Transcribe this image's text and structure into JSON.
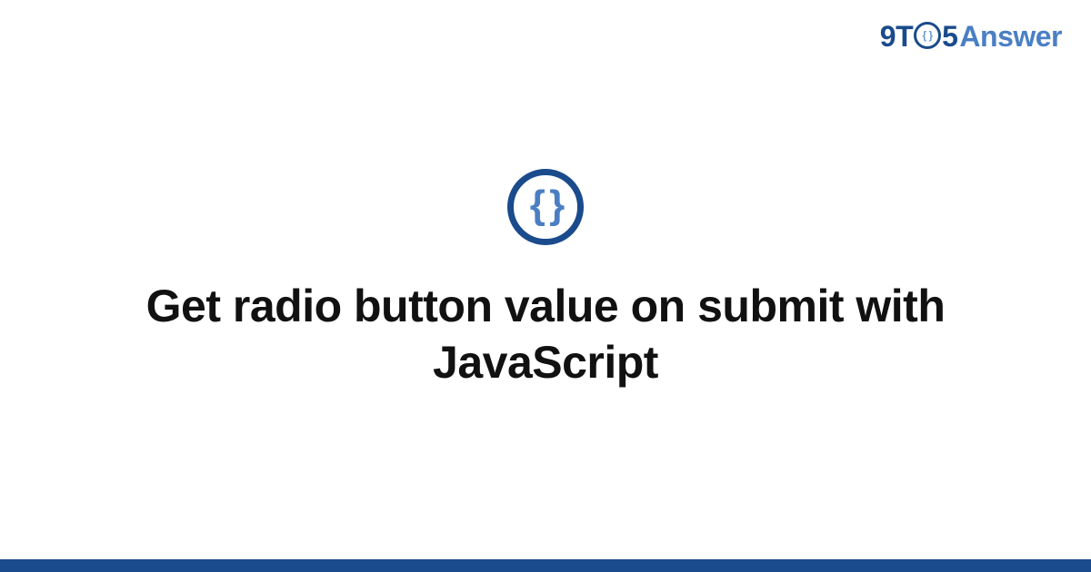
{
  "logo": {
    "part_9t": "9T",
    "part_inner": "{ }",
    "part_5": "5",
    "part_answer": "Answer"
  },
  "badge": {
    "symbol": "{ }"
  },
  "title": "Get radio button value on submit with JavaScript",
  "colors": {
    "brand_dark": "#1a4b8c",
    "brand_light": "#4a7fc4"
  }
}
